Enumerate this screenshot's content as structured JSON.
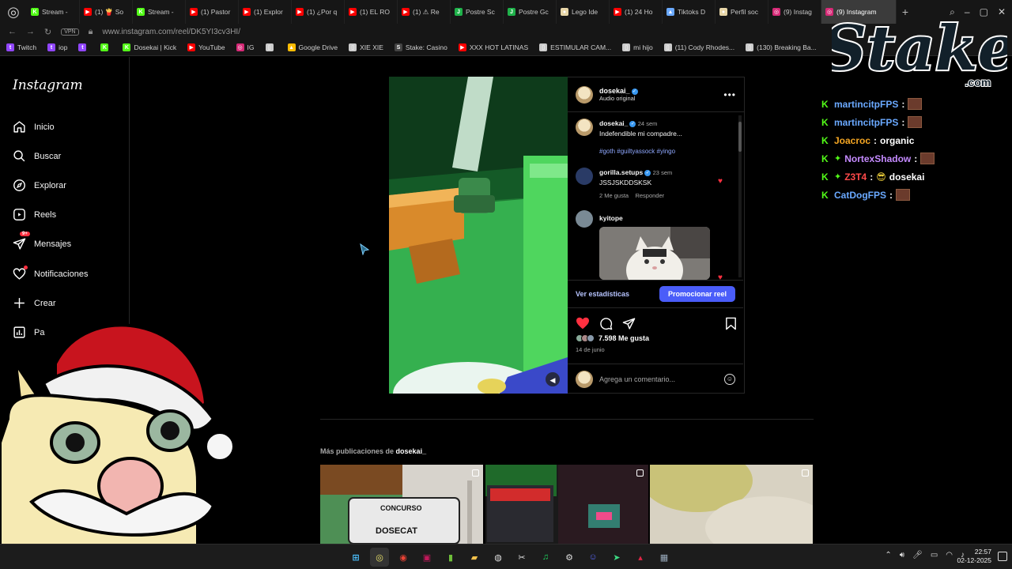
{
  "browser": {
    "tabs": [
      {
        "label": "Stream -",
        "color": "#53fc18",
        "glyph": "K"
      },
      {
        "label": "(1) 🍟 So",
        "color": "#ff0000",
        "glyph": "▶"
      },
      {
        "label": "Stream -",
        "color": "#53fc18",
        "glyph": "K"
      },
      {
        "label": "(1) Pastor",
        "color": "#ff0000",
        "glyph": "▶"
      },
      {
        "label": "(1) Explor",
        "color": "#ff0000",
        "glyph": "▶"
      },
      {
        "label": "(1) ¿Por q",
        "color": "#ff0000",
        "glyph": "▶"
      },
      {
        "label": "(1) EL RO",
        "color": "#ff0000",
        "glyph": "▶"
      },
      {
        "label": "(1) ⚠ Re",
        "color": "#ff0000",
        "glyph": "▶"
      },
      {
        "label": "Postre Sc",
        "color": "#1fb24a",
        "glyph": "J"
      },
      {
        "label": "Postre Gc",
        "color": "#1fb24a",
        "glyph": "J"
      },
      {
        "label": "Lego Ide",
        "color": "#e8d6a8",
        "glyph": "●"
      },
      {
        "label": "(1) 24 Ho",
        "color": "#ff0000",
        "glyph": "▶"
      },
      {
        "label": "Tiktoks D",
        "color": "#6aa9ff",
        "glyph": "▲"
      },
      {
        "label": "Perfil soc",
        "color": "#e8d6a8",
        "glyph": "●"
      },
      {
        "label": "(9) Instag",
        "color": "#d62976",
        "glyph": "◎"
      },
      {
        "label": "(9) Instagram",
        "color": "#d62976",
        "glyph": "◎"
      }
    ],
    "new_tab": "+",
    "url": "www.instagram.com/reel/DK5YI3cv3HI/",
    "vpn_label": "VPN",
    "bookmarks": [
      {
        "label": "Twitch",
        "color": "#9146ff",
        "glyph": "t"
      },
      {
        "label": "iop",
        "color": "#9146ff",
        "glyph": "t"
      },
      {
        "label": "",
        "color": "#9146ff",
        "glyph": "t"
      },
      {
        "label": "",
        "color": "#53fc18",
        "glyph": "K"
      },
      {
        "label": "Dosekai | Kick",
        "color": "#53fc18",
        "glyph": "K"
      },
      {
        "label": "YouTube",
        "color": "#ff0000",
        "glyph": "▶"
      },
      {
        "label": "IG",
        "color": "#d62976",
        "glyph": "◎"
      },
      {
        "label": "",
        "color": "#cccccc",
        "glyph": "▯"
      },
      {
        "label": "Google Drive",
        "color": "#fbbc04",
        "glyph": "▲"
      },
      {
        "label": "XIE XIE",
        "color": "#cccccc",
        "glyph": "▯"
      },
      {
        "label": "Stake: Casino",
        "color": "#444444",
        "glyph": "S"
      },
      {
        "label": "XXX HOT LATINAS",
        "color": "#ff0000",
        "glyph": "▶"
      },
      {
        "label": "ESTIMULAR CAM...",
        "color": "#cccccc",
        "glyph": "▯"
      },
      {
        "label": "mi hijo",
        "color": "#cccccc",
        "glyph": "▯"
      },
      {
        "label": "(11) Cody Rhodes...",
        "color": "#cccccc",
        "glyph": "▯"
      },
      {
        "label": "(130) Breaking Ba...",
        "color": "#cccccc",
        "glyph": "▯"
      }
    ]
  },
  "instagram": {
    "logo": "Instagram",
    "nav": [
      {
        "label": "Inicio",
        "icon": "home-icon"
      },
      {
        "label": "Buscar",
        "icon": "search-icon"
      },
      {
        "label": "Explorar",
        "icon": "compass-icon"
      },
      {
        "label": "Reels",
        "icon": "reels-icon"
      },
      {
        "label": "Mensajes",
        "icon": "messenger-icon",
        "badge": "9+"
      },
      {
        "label": "Notificaciones",
        "icon": "heart-icon",
        "dot": true
      },
      {
        "label": "Crear",
        "icon": "plus-icon"
      },
      {
        "label": "Pa",
        "icon": "dashboard-icon"
      }
    ],
    "post": {
      "author": "dosekai_",
      "audio": "Audio original",
      "caption_user": "dosekai_",
      "caption_time": "24 sem",
      "caption_text": "Indefendible mi compadre...",
      "caption_tags": "#goth #guiltyassock #yingo",
      "comments": [
        {
          "user": "gorilla.setups",
          "time": "23 sem",
          "text": "JSSJSKDDSKSK",
          "likes": "2 Me gusta",
          "reply": "Responder"
        },
        {
          "user": "kyitope"
        }
      ],
      "stats_link": "Ver estadísticas",
      "promote_button": "Promocionar reel",
      "likes_count": "7.598 Me gusta",
      "date": "14 de junio",
      "comment_placeholder": "Agrega un comentario...",
      "more_label": "•••"
    },
    "more_posts_prefix": "Más publicaciones de",
    "more_posts_user": "dosekai_",
    "grid_posts": [
      {
        "title": "CONCURSO",
        "subtitle": "DOSECAT",
        "multi": true
      },
      {
        "title": "",
        "subtitle": "",
        "multi": true
      },
      {
        "title": "",
        "subtitle": "",
        "multi": true
      },
      {
        "title": "",
        "subtitle": "",
        "multi": true
      }
    ]
  },
  "overlay": {
    "brand": "Stake",
    "brand_sub": ".com",
    "chat": [
      {
        "user": "martincitpFPS",
        "color": "#6aa9ff",
        "sep": ":",
        "message": "",
        "emote": true,
        "badge": false
      },
      {
        "user": "martincitpFPS",
        "color": "#6aa9ff",
        "sep": ":",
        "message": "",
        "emote": true,
        "badge": false
      },
      {
        "user": "Joacroc",
        "color": "#f5a623",
        "sep": ":",
        "message": "organic",
        "emote": false,
        "badge": false
      },
      {
        "user": "NortexShadow",
        "color": "#c58bff",
        "sep": ":",
        "message": "",
        "emote": true,
        "badge": true
      },
      {
        "user": "Z3T4",
        "color": "#ff4a4a",
        "sep": ":",
        "message": "dosekai",
        "emote": false,
        "badge": true,
        "face_emote": true
      },
      {
        "user": "CatDogFPS",
        "color": "#6aa9ff",
        "sep": ":",
        "message": "",
        "emote": true,
        "badge": false
      }
    ]
  },
  "taskbar": {
    "time": "22:57",
    "date": "02-12-2025"
  }
}
